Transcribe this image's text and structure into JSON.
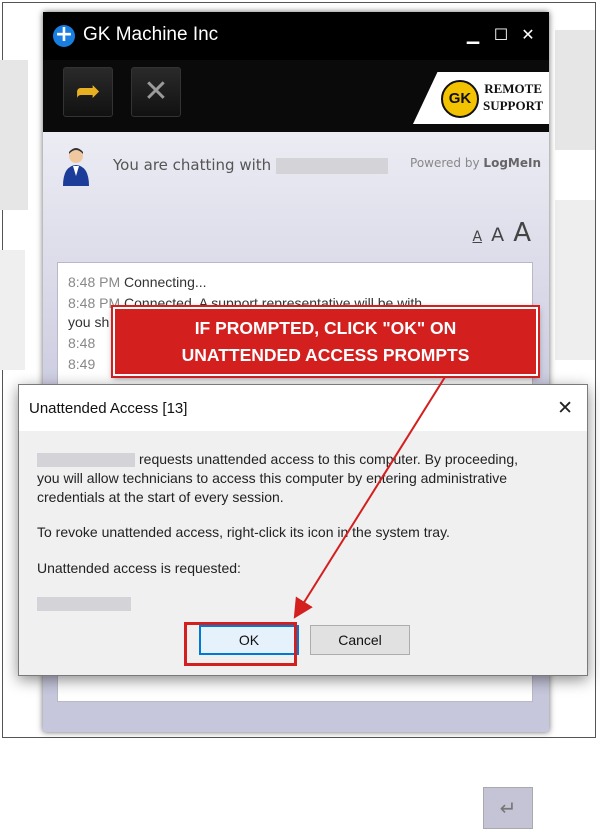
{
  "chat_window": {
    "title": "GK Machine Inc",
    "controls": {
      "minimize": "▁",
      "maximize": "☐",
      "close": "✕"
    },
    "brand": {
      "logo_text": "GK",
      "line1": "REMOTE",
      "line2": "SUPPORT"
    },
    "chatting_label": "You are chatting with",
    "powered_by": "Powered by",
    "powered_brand": "LogMeIn",
    "font_sizes": [
      "A",
      "A",
      "A"
    ],
    "log": [
      {
        "time": "8:48 PM",
        "text": "Connecting..."
      },
      {
        "time": "8:48 PM",
        "text": "Connected. A support representative will be with"
      },
      {
        "time": "",
        "text": "you sh"
      },
      {
        "time": "8:48",
        "text": ""
      },
      {
        "time": "8:49",
        "text": ""
      }
    ],
    "send_icon": "↵"
  },
  "callout": {
    "line1": "IF PROMPTED, CLICK \"OK\" ON",
    "line2": "UNATTENDED ACCESS PROMPTS",
    "color": "#d41f1f"
  },
  "dialog": {
    "title": "Unattended Access [13]",
    "close": "✕",
    "para1_line1": "requests unattended access to this computer. By proceeding,",
    "para1_line2": "you will allow technicians to access this computer by entering administrative",
    "para1_line3": "credentials at the start of every session.",
    "para2": "To revoke unattended access, right-click its icon in the system tray.",
    "para3": "Unattended access is requested:",
    "ok_label": "OK",
    "cancel_label": "Cancel"
  }
}
